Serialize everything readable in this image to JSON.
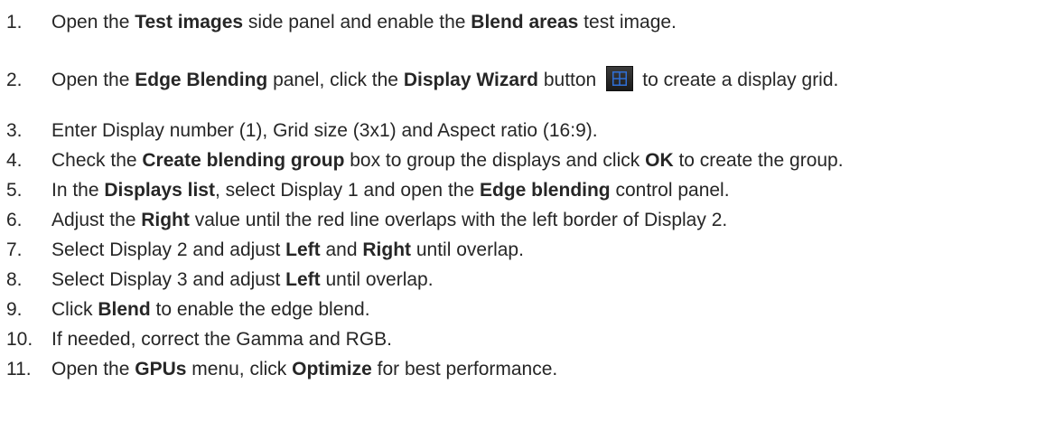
{
  "steps": [
    {
      "number": "1.",
      "parts": [
        "Open the ",
        "Test images",
        " side panel and enable the ",
        "Blend areas",
        " test image."
      ]
    },
    {
      "number": "2.",
      "parts": [
        "Open the ",
        "Edge Blending",
        " panel, click the ",
        "Display Wizard",
        " button",
        "to create a display grid."
      ]
    },
    {
      "number": "3.",
      "text": "Enter Display number (1), Grid size (3x1) and Aspect ratio (16:9)."
    },
    {
      "number": "4.",
      "parts": [
        "Check the ",
        "Create blending group",
        " box to group the displays and click ",
        "OK",
        " to create the group."
      ]
    },
    {
      "number": "5.",
      "parts": [
        "In the ",
        "Displays list",
        ", select Display 1 and open the ",
        "Edge blending",
        " control panel."
      ]
    },
    {
      "number": "6.",
      "parts": [
        "Adjust the ",
        "Right",
        " value until the red line overlaps with the left border of Display 2."
      ]
    },
    {
      "number": "7.",
      "parts": [
        "Select Display 2 and adjust ",
        "Left",
        " and ",
        "Right",
        " until overlap."
      ]
    },
    {
      "number": "8.",
      "parts": [
        "Select Display 3 and adjust ",
        "Left",
        " until overlap."
      ]
    },
    {
      "number": "9.",
      "parts": [
        "Click ",
        "Blend",
        " to enable the edge blend."
      ]
    },
    {
      "number": "10.",
      "text": "If needed, correct the Gamma and RGB."
    },
    {
      "number": "11.",
      "parts": [
        "Open the ",
        "GPUs",
        " menu, click ",
        "Optimize",
        " for best performance."
      ]
    }
  ],
  "icons": {
    "display_wizard": "grid-icon"
  },
  "colors": {
    "text": "#262626",
    "icon_bg": "#2a2a2a",
    "icon_grid": "#2f6fd6"
  }
}
